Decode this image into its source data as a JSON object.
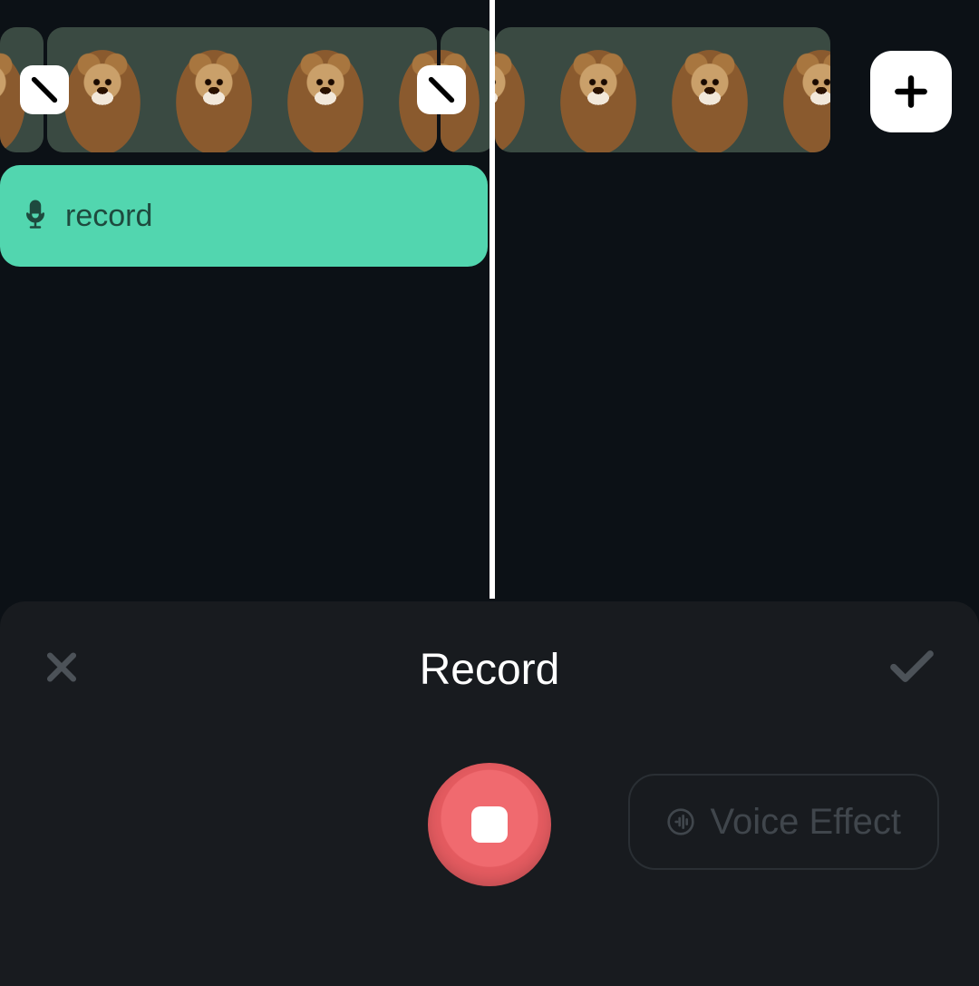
{
  "timeline": {
    "record_track_label": "record"
  },
  "panel": {
    "title": "Record",
    "voice_effect_label": "Voice Effect"
  },
  "icons": {
    "mute": "mute-slash-icon",
    "add": "plus-icon",
    "mic": "microphone-icon",
    "close": "close-icon",
    "confirm": "check-icon",
    "voice": "voice-waves-icon"
  }
}
